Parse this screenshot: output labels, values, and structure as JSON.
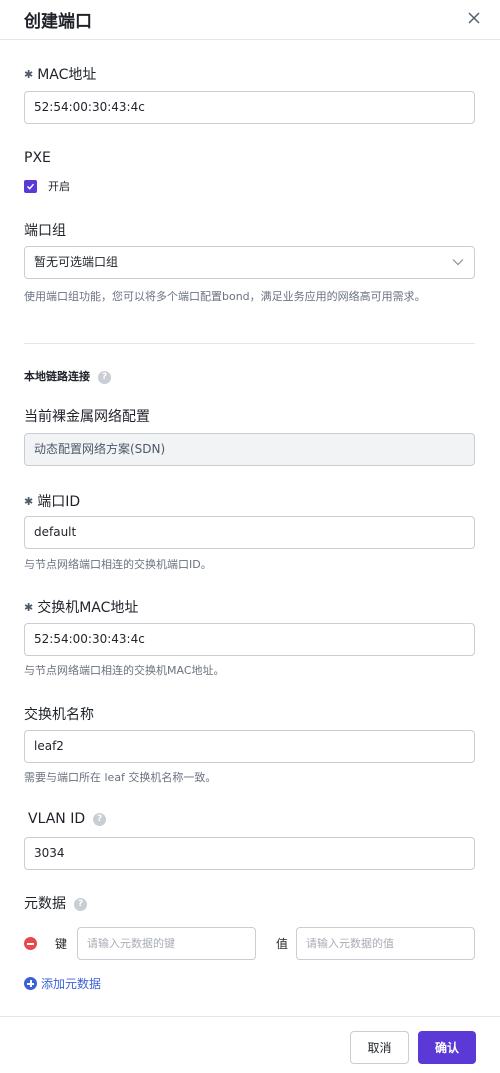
{
  "dialog": {
    "title": "创建端口"
  },
  "mac": {
    "label": "MAC地址",
    "value": "52:54:00:30:43:4c"
  },
  "pxe": {
    "label": "PXE",
    "checkbox_label": "开启",
    "checked": true
  },
  "port_group": {
    "label": "端口组",
    "value": "暂无可选端口组",
    "help": "使用端口组功能，您可以将多个端口配置bond，满足业务应用的网络高可用需求。"
  },
  "local_link": {
    "section_title": "本地链路连接",
    "network_config": {
      "label": "当前裸金属网络配置",
      "value": "动态配置网络方案(SDN)"
    },
    "port_id": {
      "label": "端口ID",
      "value": "default",
      "help": "与节点网络端口相连的交换机端口ID。"
    },
    "switch_mac": {
      "label": "交换机MAC地址",
      "value": "52:54:00:30:43:4c",
      "help": "与节点网络端口相连的交换机MAC地址。"
    },
    "switch_name": {
      "label": "交换机名称",
      "value": "leaf2",
      "help": "需要与端口所在 leaf 交换机名称一致。"
    },
    "vlan": {
      "label": "VLAN ID",
      "value": "3034"
    }
  },
  "metadata": {
    "label": "元数据",
    "key_label": "键",
    "key_placeholder": "请输入元数据的键",
    "value_label": "值",
    "value_placeholder": "请输入元数据的值",
    "add_label": "添加元数据"
  },
  "footer": {
    "cancel": "取消",
    "confirm": "确认"
  },
  "colors": {
    "primary": "#5a39d6",
    "link": "#3b61d6",
    "danger": "#e8474c"
  }
}
